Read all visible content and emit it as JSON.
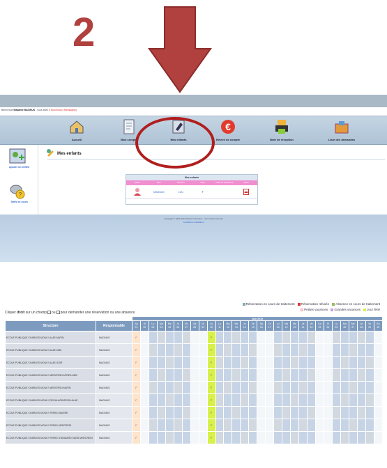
{
  "step_number": "2",
  "colors": {
    "arrow": "#b0413e",
    "highlight_circle": "#b01e1e",
    "nav_band": "#aec3d6",
    "holiday_header": "#f08ecf",
    "jour_ferie": "#d8f04a",
    "petites_vacances": "#fde4cc"
  },
  "portal": {
    "welcome": {
      "prefix": "Bienvenue",
      "name": "Madame MAGNUS",
      "rest": "- vous avez",
      "messages": "0 Nouveau(x) Message(s)"
    },
    "nav": [
      {
        "label": "Accueil",
        "icon": "house-icon"
      },
      {
        "label": "Mon compte",
        "icon": "document-icon"
      },
      {
        "label": "Mes enfants",
        "icon": "children-icon"
      },
      {
        "label": "Relevé de compte",
        "icon": "euro-icon"
      },
      {
        "label": "Note de réception",
        "icon": "printer-icon"
      },
      {
        "label": "Liste des demandes",
        "icon": "inbox-icon"
      }
    ],
    "sidebar": [
      {
        "label": "Ajouter un enfant",
        "icon": "add-child-icon"
      },
      {
        "label": "Tarifs en cours",
        "icon": "coins-icon"
      }
    ],
    "main_title": "Mes enfants",
    "children_table": {
      "title": "Mes enfants",
      "columns": [
        "Photo",
        "Nom",
        "Prénom",
        "Sexe",
        "Date de naissance",
        "Fiche"
      ],
      "rows": [
        {
          "nom": "MAGNUS",
          "prenom": "LOU",
          "sexe": "F"
        }
      ]
    },
    "footer": {
      "copyright": "Copyright © 2004-2019 Abelium Domaine - Tous droits réservés",
      "link": "Conditions d'utilisation"
    }
  },
  "legend": {
    "line1": [
      {
        "label": "Réservation en cours de traitement",
        "color": "#8aa"
      },
      {
        "label": "Réservation refusée",
        "color": "#d33"
      },
      {
        "label": "Absence en cours de traitement",
        "color": "#9b6"
      }
    ],
    "line2": [
      {
        "label": "Petites vacances",
        "color": "#fde4cc"
      },
      {
        "label": "Grandes vacances",
        "color": "#c9a0e8"
      },
      {
        "label": "Jour férié",
        "color": "#d8f04a"
      }
    ]
  },
  "instruction": {
    "pre": "Cliquer",
    "bold": "droit",
    "mid": "sur un champ",
    "ou": "ou",
    "post": "pour demander une réservation ou une absence"
  },
  "calendar": {
    "month": "Juin 2019",
    "header_structure": "Structure",
    "header_responsable": "Responsable",
    "days": [
      [
        "Sa",
        "01"
      ],
      [
        "Di",
        "02"
      ],
      [
        "Lu",
        "03"
      ],
      [
        "Ma",
        "04"
      ],
      [
        "Me",
        "05"
      ],
      [
        "Je",
        "06"
      ],
      [
        "Ve",
        "07"
      ],
      [
        "Sa",
        "08"
      ],
      [
        "Di",
        "09"
      ],
      [
        "Lu",
        "10"
      ],
      [
        "Lu",
        "11"
      ],
      [
        "Ma",
        "12"
      ],
      [
        "Me",
        "13"
      ],
      [
        "Je",
        "14"
      ],
      [
        "Ve",
        "15"
      ],
      [
        "Sa",
        "16"
      ],
      [
        "Di",
        "17"
      ],
      [
        "Lu",
        "18"
      ],
      [
        "Ma",
        "19"
      ],
      [
        "Me",
        "20"
      ],
      [
        "Je",
        "21"
      ],
      [
        "Ve",
        "22"
      ],
      [
        "Sa",
        "23"
      ],
      [
        "Di",
        "24"
      ],
      [
        "Lu",
        "25"
      ],
      [
        "Ma",
        "26"
      ],
      [
        "Me",
        "27"
      ],
      [
        "Je",
        "28"
      ],
      [
        "Ve",
        "29"
      ],
      [
        "Sa",
        "30"
      ]
    ],
    "f_label": "F",
    "rows": [
      {
        "structure": "ECOLE PUBLIQUE CHARLES MOULY ALAE MATIN",
        "responsable": "MAGNUS"
      },
      {
        "structure": "ECOLE PUBLIQUE CHARLES MOULY ALAE MIDI",
        "responsable": "MAGNUS"
      },
      {
        "structure": "ECOLE PUBLIQUE CHARLES MOULY ALAE SOIR",
        "responsable": "MAGNUS"
      },
      {
        "structure": "ECOLE PUBLIQUE CHARLES MOULY MERCREDI APRES-MIDI",
        "responsable": "MAGNUS"
      },
      {
        "structure": "ECOLE PUBLIQUE CHARLES MOULY MERCREDI MATIN",
        "responsable": "MAGNUS"
      },
      {
        "structure": "ECOLE PUBLIQUE CHARLES MOULY REGULARISATION ALAE",
        "responsable": "MAGNUS"
      },
      {
        "structure": "ECOLE PUBLIQUE CHARLES MOULY REPAS MAIGRE",
        "responsable": "MAGNUS"
      },
      {
        "structure": "ECOLE PUBLIQUE CHARLES MOULY REPAS MERCREDI",
        "responsable": "MAGNUS"
      },
      {
        "structure": "ECOLE PUBLIQUE CHARLES MOULY REPAS STANDARD SANS MERCREDI",
        "responsable": "MAGNUS"
      }
    ]
  }
}
